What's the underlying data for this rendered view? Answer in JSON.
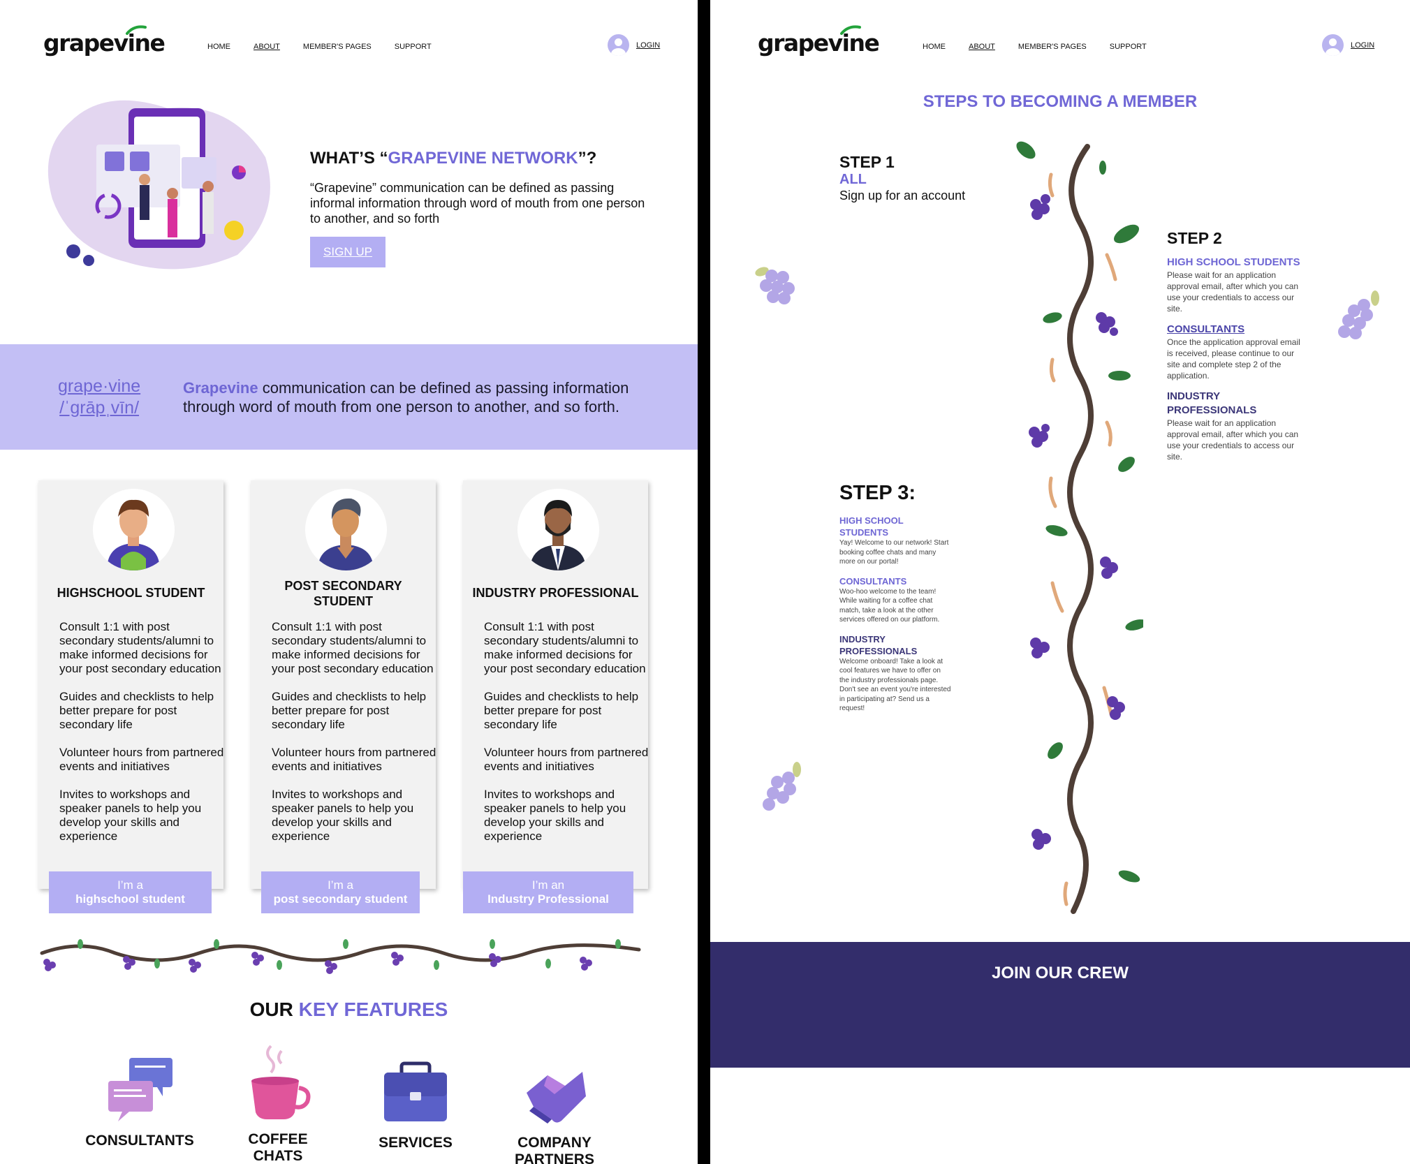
{
  "brand": {
    "name": "grapevine"
  },
  "nav": {
    "items": [
      "HOME",
      "ABOUT",
      "MEMBER'S PAGES",
      "SUPPORT"
    ],
    "login": "LOGIN"
  },
  "hero": {
    "title_prefix": "WHAT’S “",
    "title_accent": "GRAPEVINE NETWORK",
    "title_suffix": "”?",
    "text": "“Grapevine” communication can be defined as passing informal information through word of mouth from one person to another, and so forth",
    "signup_button": "SIGN UP"
  },
  "definition": {
    "word": "grape·vine",
    "pronunciation": "/ˈɡrāpˌvīn/",
    "accent": "Grapevine",
    "text": " communication can be defined as passing information through word of mouth from one person to another, and so forth."
  },
  "cards": [
    {
      "title": "HIGHSCHOOL STUDENT",
      "points": [
        "Consult 1:1 with post secondary students/alumni to make informed decisions for your post secondary education",
        "Guides and checklists to help better prepare for post secondary life",
        "Volunteer hours from partnered events and initiatives",
        "Invites to workshops and speaker panels to help you develop your skills and experience"
      ],
      "cta_line1": "I’m a",
      "cta_line2": "highschool student"
    },
    {
      "title": "POST SECONDARY STUDENT",
      "points": [
        "Consult 1:1 with post secondary students/alumni to make informed decisions for your post secondary education",
        "Guides and checklists to help better prepare for post secondary life",
        "Volunteer hours from partnered events and initiatives",
        "Invites to workshops and speaker panels to help you develop your skills and experience"
      ],
      "cta_line1": "I’m a",
      "cta_line2": "post secondary student"
    },
    {
      "title": "INDUSTRY PROFESSIONAL",
      "points": [
        "Consult 1:1 with post secondary students/alumni to make informed decisions for your post secondary education",
        "Guides and checklists to help better prepare for post secondary life",
        "Volunteer hours from partnered events and initiatives",
        "Invites to workshops and speaker panels to help you develop your skills and experience"
      ],
      "cta_line1": "I’m an",
      "cta_line2": "Industry Professional"
    }
  ],
  "key_features": {
    "title_prefix": "OUR ",
    "title_accent": "KEY FEATURES",
    "items": [
      "CONSULTANTS",
      "COFFEE CHATS",
      "SERVICES",
      "COMPANY PARTNERS"
    ]
  },
  "steps": {
    "title": "STEPS TO BECOMING A MEMBER",
    "step1": {
      "heading": "STEP 1",
      "sub": "ALL",
      "text": "Sign up for an account"
    },
    "step2": {
      "heading": "STEP 2",
      "groups": [
        {
          "title": "HIGH SCHOOL STUDENTS",
          "text": "Please wait for an application approval email, after which you can use your credentials to access our site."
        },
        {
          "title": "CONSULTANTS",
          "text": "Once the application approval email is received, please continue to our site and complete step 2 of the application."
        },
        {
          "title": "INDUSTRY PROFESSIONALS",
          "text": "Please wait for an application approval email, after which you can use your credentials to access our site."
        }
      ]
    },
    "step3": {
      "heading": "STEP 3:",
      "groups": [
        {
          "title": "HIGH SCHOOL STUDENTS",
          "text": "Yay! Welcome to our network! Start booking coffee chats and many more on our portal!"
        },
        {
          "title": "CONSULTANTS",
          "text": "Woo-hoo welcome to the team! While waiting for a coffee chat match, take a look at the other services offered on our platform."
        },
        {
          "title": "INDUSTRY PROFESSIONALS",
          "text": "Welcome onboard! Take a look at cool features we have to offer on the industry professionals page. Don't see an event you're interested in participating at? Send us a request!"
        }
      ]
    }
  },
  "join": {
    "title": "JOIN OUR CREW"
  },
  "colors": {
    "accent": "#7067d6",
    "band": "#c3bff5",
    "button": "#b3aef3",
    "dark": "#332d6b",
    "vine": "#4e3e36"
  }
}
